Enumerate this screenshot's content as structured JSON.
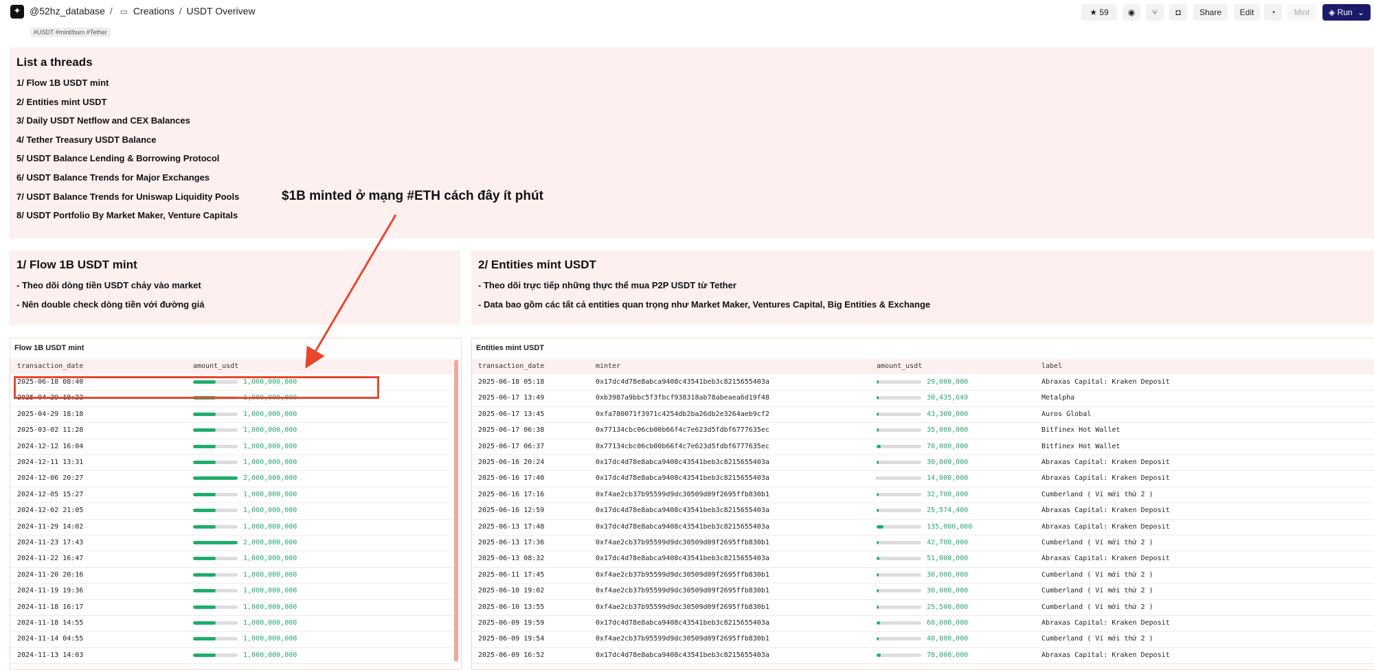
{
  "header": {
    "org": "@52hz_database",
    "breadcrumb_sep": "/",
    "folder": "Creations",
    "dashboard": "USDT Overivew",
    "tags": "#USDT #mint/burn #Tether",
    "star_count": "59",
    "share_label": "Share",
    "edit_label": "Edit",
    "mint_label": "Mint",
    "run_label": "Run"
  },
  "threads": {
    "title": "List a threads",
    "items": [
      "1/ Flow 1B USDT mint",
      "2/ Entities mint USDT",
      "3/ Daily USDT Netflow and CEX Balances",
      "4/ Tether Treasury USDT Balance",
      "5/ USDT Balance Lending & Borrowing Protocol",
      "6/ USDT Balance Trends for Major Exchanges",
      "7/ USDT Balance Trends for Uniswap Liquidity Pools",
      "8/ USDT Portfolio By Market Maker, Venture Capitals"
    ]
  },
  "annotation": "$1B minted ở mạng #ETH cách đây ít phút",
  "section1": {
    "title": "1/ Flow 1B USDT mint",
    "lines": [
      "- Theo dõi dòng tiền USDT chảy vào market",
      "- Nên double check dòng tiền với đường giá"
    ]
  },
  "section2": {
    "title": "2/ Entities mint USDT",
    "lines": [
      "- Theo dõi trực tiếp những thực thể mua P2P USDT từ Tether",
      "- Data bao gồm các tất cả entities quan trọng như Market Maker, Ventures Capital, Big Entities & Exchange"
    ]
  },
  "table1": {
    "caption": "Flow 1B USDT mint",
    "columns": [
      "transaction_date",
      "amount_usdt"
    ],
    "rows": [
      {
        "date": "2025-06-18 08:40",
        "amount": "1,000,000,000",
        "level": 0.5
      },
      {
        "date": "2025-04-29 18:22",
        "amount": "1,000,000,000",
        "level": 0.5
      },
      {
        "date": "2025-04-29 18:18",
        "amount": "1,000,000,000",
        "level": 0.5
      },
      {
        "date": "2025-03-02 11:28",
        "amount": "1,000,000,000",
        "level": 0.5
      },
      {
        "date": "2024-12-12 16:04",
        "amount": "1,000,000,000",
        "level": 0.5
      },
      {
        "date": "2024-12-11 13:31",
        "amount": "1,000,000,000",
        "level": 0.5
      },
      {
        "date": "2024-12-06 20:27",
        "amount": "2,000,000,000",
        "level": 1.0
      },
      {
        "date": "2024-12-05 15:27",
        "amount": "1,000,000,000",
        "level": 0.5
      },
      {
        "date": "2024-12-02 21:05",
        "amount": "1,000,000,000",
        "level": 0.5
      },
      {
        "date": "2024-11-29 14:02",
        "amount": "1,000,000,000",
        "level": 0.5
      },
      {
        "date": "2024-11-23 17:43",
        "amount": "2,000,000,000",
        "level": 1.0
      },
      {
        "date": "2024-11-22 16:47",
        "amount": "1,000,000,000",
        "level": 0.5
      },
      {
        "date": "2024-11-20 20:16",
        "amount": "1,000,000,000",
        "level": 0.5
      },
      {
        "date": "2024-11-19 19:36",
        "amount": "1,000,000,000",
        "level": 0.5
      },
      {
        "date": "2024-11-18 16:17",
        "amount": "1,000,000,000",
        "level": 0.5
      },
      {
        "date": "2024-11-18 14:55",
        "amount": "1,000,000,000",
        "level": 0.5
      },
      {
        "date": "2024-11-14 04:55",
        "amount": "1,000,000,000",
        "level": 0.5
      },
      {
        "date": "2024-11-13 14:03",
        "amount": "1,000,000,000",
        "level": 0.5
      }
    ]
  },
  "table2": {
    "caption": "Entities mint USDT",
    "columns": [
      "transaction_date",
      "minter",
      "amount_usdt",
      "label"
    ],
    "rows": [
      {
        "date": "2025-06-18 05:18",
        "minter": "0x17dc4d78e8abca9408c43541beb3c8215655403a",
        "amount": "29,000,000",
        "level": 0.05,
        "label": "Abraxas Capital: Kraken Deposit"
      },
      {
        "date": "2025-06-17 13:49",
        "minter": "0xb3987a9bbc5f3fbcf938318ab78abeaea6d19f48",
        "amount": "30,435,649",
        "level": 0.05,
        "label": "Metalpha"
      },
      {
        "date": "2025-06-17 13:45",
        "minter": "0xfa780071f3971c4254db2ba26db2e3264aeb9cf2",
        "amount": "43,300,000",
        "level": 0.05,
        "label": "Auros Global"
      },
      {
        "date": "2025-06-17 06:38",
        "minter": "0x77134cbc06cb00b66f4c7e623d5fdbf6777635ec",
        "amount": "35,000,000",
        "level": 0.05,
        "label": "Bitfinex Hot Wallet"
      },
      {
        "date": "2025-06-17 06:37",
        "minter": "0x77134cbc06cb00b66f4c7e623d5fdbf6777635ec",
        "amount": "70,000,000",
        "level": 0.09,
        "label": "Bitfinex Hot Wallet"
      },
      {
        "date": "2025-06-16 20:24",
        "minter": "0x17dc4d78e8abca9408c43541beb3c8215655403a",
        "amount": "30,000,000",
        "level": 0.05,
        "label": "Abraxas Capital: Kraken Deposit"
      },
      {
        "date": "2025-06-16 17:40",
        "minter": "0x17dc4d78e8abca9408c43541beb3c8215655403a",
        "amount": "14,000,000",
        "level": 0.02,
        "label": "Abraxas Capital: Kraken Deposit"
      },
      {
        "date": "2025-06-16 17:16",
        "minter": "0xf4ae2cb37b95599d9dc30509d09f2695ffb830b1",
        "amount": "32,700,000",
        "level": 0.05,
        "label": "Cumberland ( Ví mới thứ 2 )"
      },
      {
        "date": "2025-06-16 12:59",
        "minter": "0x17dc4d78e8abca9408c43541beb3c8215655403a",
        "amount": "25,574,400",
        "level": 0.04,
        "label": "Abraxas Capital: Kraken Deposit"
      },
      {
        "date": "2025-06-13 17:48",
        "minter": "0x17dc4d78e8abca9408c43541beb3c8215655403a",
        "amount": "135,000,000",
        "level": 0.15,
        "label": "Abraxas Capital: Kraken Deposit"
      },
      {
        "date": "2025-06-13 17:36",
        "minter": "0xf4ae2cb37b95599d9dc30509d09f2695ffb830b1",
        "amount": "42,700,000",
        "level": 0.05,
        "label": "Cumberland ( Ví mới thứ 2 )"
      },
      {
        "date": "2025-06-13 08:32",
        "minter": "0x17dc4d78e8abca9408c43541beb3c8215655403a",
        "amount": "51,000,000",
        "level": 0.06,
        "label": "Abraxas Capital: Kraken Deposit"
      },
      {
        "date": "2025-06-11 17:45",
        "minter": "0xf4ae2cb37b95599d9dc30509d09f2695ffb830b1",
        "amount": "30,000,000",
        "level": 0.05,
        "label": "Cumberland ( Ví mới thứ 2 )"
      },
      {
        "date": "2025-06-10 19:02",
        "minter": "0xf4ae2cb37b95599d9dc30509d09f2695ffb830b1",
        "amount": "30,000,000",
        "level": 0.05,
        "label": "Cumberland ( Ví mới thứ 2 )"
      },
      {
        "date": "2025-06-10 13:55",
        "minter": "0xf4ae2cb37b95599d9dc30509d09f2695ffb830b1",
        "amount": "25,500,000",
        "level": 0.04,
        "label": "Cumberland ( Ví mới thứ 2 )"
      },
      {
        "date": "2025-06-09 19:59",
        "minter": "0x17dc4d78e8abca9408c43541beb3c8215655403a",
        "amount": "60,000,000",
        "level": 0.07,
        "label": "Abraxas Capital: Kraken Deposit"
      },
      {
        "date": "2025-06-09 19:54",
        "minter": "0xf4ae2cb37b95599d9dc30509d09f2695ffb830b1",
        "amount": "40,800,000",
        "level": 0.05,
        "label": "Cumberland ( Ví mới thứ 2 )"
      },
      {
        "date": "2025-06-09 16:52",
        "minter": "0x17dc4d78e8abca9408c43541beb3c8215655403a",
        "amount": "78,000,000",
        "level": 0.09,
        "label": "Abraxas Capital: Kraken Deposit"
      }
    ]
  },
  "colors": {
    "accent": "#1c1b6a",
    "panel_bg": "#fdf0ee",
    "bar_fill": "#1fae6a",
    "amount_text": "#27a76a",
    "highlight": "#e8452d"
  }
}
